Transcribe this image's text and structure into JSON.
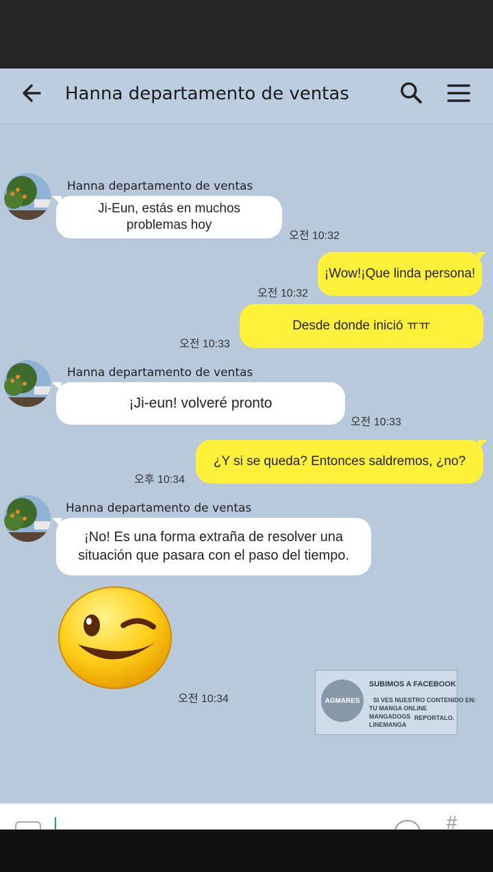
{
  "header": {
    "title": "Hanna departamento de ventas"
  },
  "messages": [
    {
      "sender": "Hanna departamento de ventas",
      "text_lines": [
        "Ji-Eun, estás en muchos",
        "problemas hoy"
      ],
      "time": "오전 10:32"
    },
    {
      "text": "¡Wow!¡Que linda persona!",
      "time": "오전 10:32"
    },
    {
      "text": "Desde donde inició  ㅠㅠ",
      "time": "오전 10:33"
    },
    {
      "sender": "Hanna departamento de ventas",
      "text": "¡Ji-eun! volveré pronto",
      "time": "오전 10:33"
    },
    {
      "text": "¿Y si se queda? Entonces saldremos, ¿no?",
      "time": "오후 10:34"
    },
    {
      "sender": "Hanna departamento de ventas",
      "text_lines": [
        "¡No! Es una forma extraña de resolver una",
        "situación que pasara con el paso del tiempo."
      ],
      "time": "오전 10:34",
      "emoji": "winking-face-icon"
    }
  ],
  "watermark": {
    "badge": "AGMARES",
    "title": "SUBIMOS A FACEBOOK",
    "line1": "SI VES NUESTRO CONTENIDO EN:",
    "line2": "TU MANGA ONLINE",
    "line3": "MANGADOGS",
    "line4": "LINEMANGA",
    "line5": "REPORTALO."
  },
  "colors": {
    "chat_bg": "#b9c9dc",
    "my_bubble": "#fff03a",
    "their_bubble": "#ffffff"
  }
}
